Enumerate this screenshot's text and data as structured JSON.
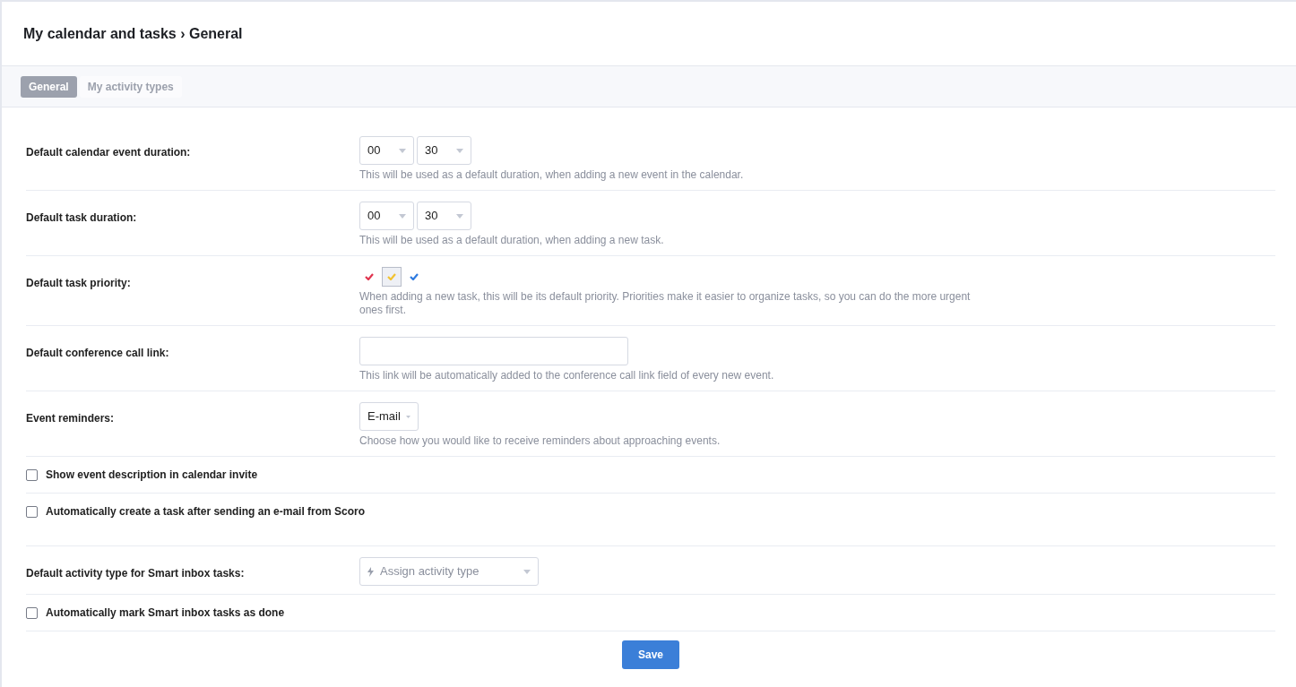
{
  "title": "My calendar and tasks › General",
  "tabs": [
    {
      "label": "General",
      "selected": true
    },
    {
      "label": "My activity types",
      "selected": false
    }
  ],
  "rows": [
    {
      "kind": "duration",
      "label": "Default calendar event duration:",
      "hours": "00",
      "minutes": "30",
      "hint": "This will be used as a default duration, when adding a new event in the calendar."
    },
    {
      "kind": "duration",
      "label": "Default task duration:",
      "hours": "00",
      "minutes": "30",
      "hint": "This will be used as a default duration, when adding a new task."
    },
    {
      "kind": "priority",
      "label": "Default task priority:",
      "priorities": [
        {
          "color": "#e0344e",
          "selected": false
        },
        {
          "color": "#f2c230",
          "selected": true
        },
        {
          "color": "#2f7be0",
          "selected": false
        }
      ],
      "hint": "When adding a new task, this will be its default priority. Priorities make it easier to organize tasks, so you can do the more urgent ones first."
    },
    {
      "kind": "text",
      "label": "Default conference call link:",
      "hint": "This link will be automatically added to the conference call link field of every new event."
    },
    {
      "kind": "select",
      "label": "Event reminders:",
      "value": "E-mail",
      "hint": "Choose how you would like to receive reminders about approaching events."
    },
    {
      "kind": "checkbox",
      "label": "Show event description in calendar invite",
      "checked": false
    },
    {
      "kind": "checkbox",
      "label": "Automatically create a task after sending an e-mail from Scoro",
      "checked": false,
      "tall": true
    },
    {
      "kind": "activity",
      "label": "Default activity type for Smart inbox tasks:",
      "placeholder": "Assign activity type"
    },
    {
      "kind": "checkbox",
      "label": "Automatically mark Smart inbox tasks as done",
      "checked": false
    }
  ],
  "save_button": "Save"
}
